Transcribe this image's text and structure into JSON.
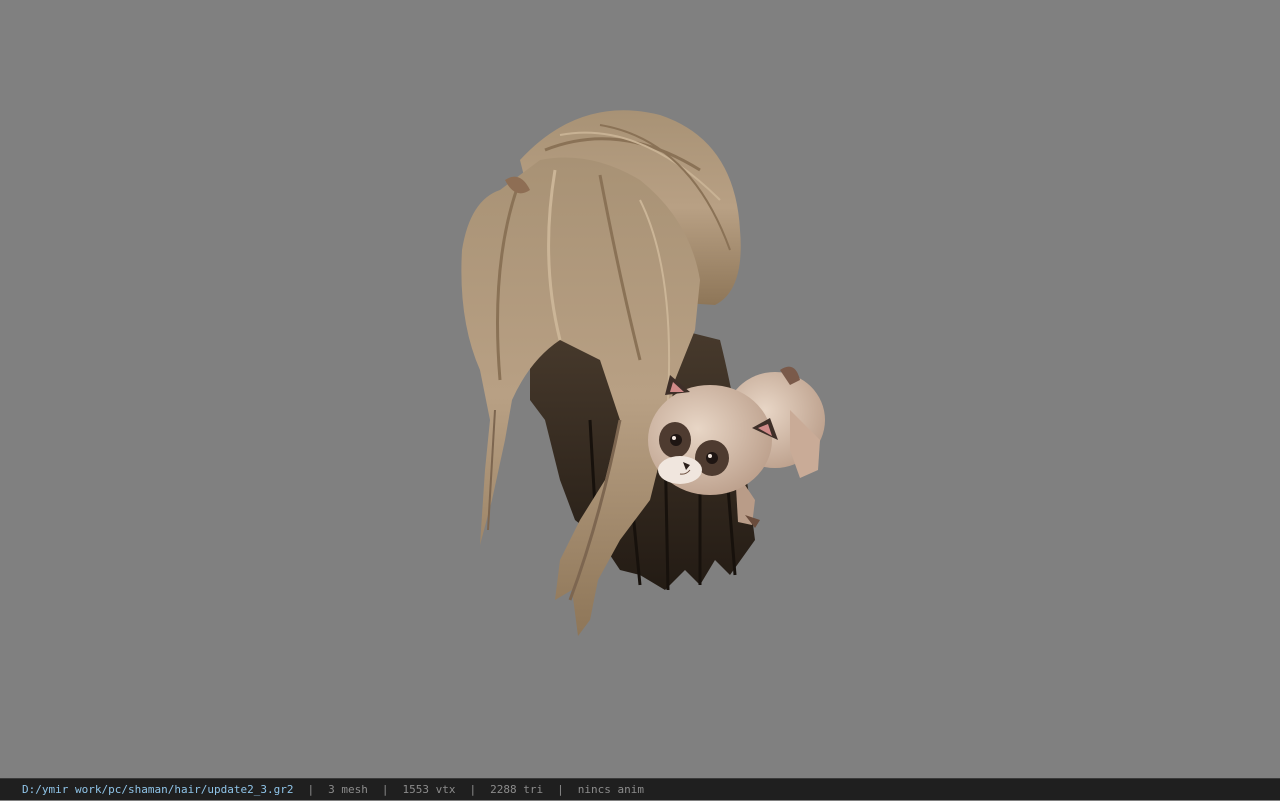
{
  "viewer": {
    "background_color": "#808080",
    "model_icon": "hair-model-with-raccoon-plush"
  },
  "status_bar": {
    "file_path": "D:/ymir work/pc/shaman/hair/update2_3.gr2",
    "separator": "|",
    "mesh_count": "3 mesh",
    "vertex_count": "1553 vtx",
    "triangle_count": "2288 tri",
    "anim_status": "nincs anim"
  },
  "colors": {
    "status_bg": "#1f1f1f",
    "path_text": "#8fc4e8",
    "stat_text": "#8c8c8c",
    "hair_light": "#b39b7c",
    "hair_dark": "#2c231b",
    "plush_body": "#d9c2b0"
  }
}
